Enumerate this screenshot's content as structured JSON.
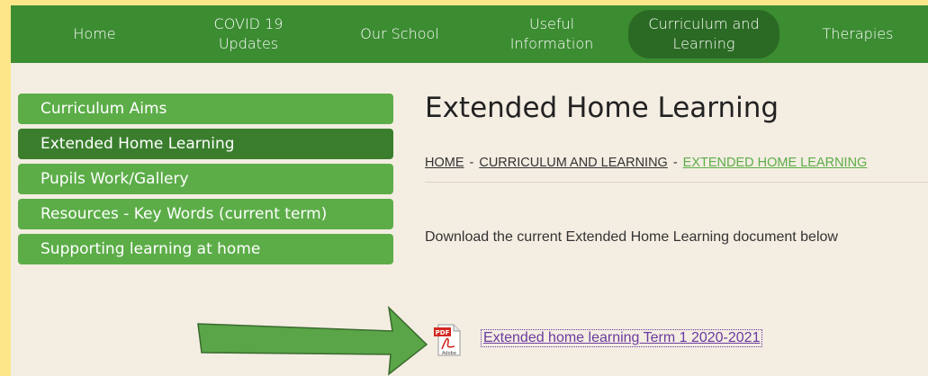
{
  "nav": {
    "items": [
      {
        "label_line1": "Home",
        "label_line2": ""
      },
      {
        "label_line1": "COVID 19",
        "label_line2": "Updates"
      },
      {
        "label_line1": "Our School",
        "label_line2": ""
      },
      {
        "label_line1": "Useful",
        "label_line2": "Information"
      },
      {
        "label_line1": "Curriculum and",
        "label_line2": "Learning"
      },
      {
        "label_line1": "Therapies",
        "label_line2": ""
      }
    ],
    "active_index": 4
  },
  "sidebar": {
    "items": [
      {
        "label": "Curriculum Aims"
      },
      {
        "label": "Extended Home Learning"
      },
      {
        "label": "Pupils Work/Gallery"
      },
      {
        "label": "Resources - Key Words (current term)"
      },
      {
        "label": "Supporting learning at home"
      }
    ],
    "active_index": 1
  },
  "main": {
    "title": "Extended Home Learning",
    "breadcrumb": [
      "HOME",
      "CURRICULUM AND LEARNING",
      "EXTENDED HOME LEARNING"
    ],
    "breadcrumb_sep": "-",
    "description": "Download the current Extended  Home Learning document below",
    "download": {
      "icon": "pdf-file-icon",
      "icon_badge": "PDF",
      "icon_caption": "Adobe",
      "link_text": "Extended home learning Term 1 2020-2021"
    }
  },
  "annotation": {
    "icon": "arrow-right-icon",
    "color": "#5aa548"
  },
  "colors": {
    "nav_bg": "#3c8c32",
    "nav_active": "#2b6a24",
    "sidebar_item": "#5cad48",
    "sidebar_active": "#3a7e2d",
    "page_bg": "#f4ede2",
    "border": "#fde68a",
    "link": "#6a3aa0"
  }
}
